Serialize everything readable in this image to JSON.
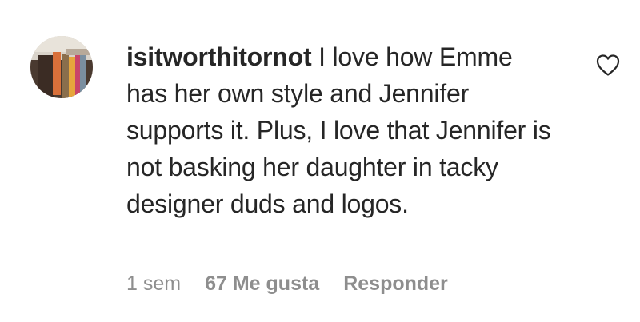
{
  "comment": {
    "username": "isitworthitornot",
    "text": "I love how Emme has her own style and Jennifer supports it. Plus, I love that Jennifer is not basking her daughter in tacky designer duds and logos.",
    "time": "1 sem",
    "likes": "67 Me gusta",
    "reply_label": "Responder",
    "like_icon": "heart-outline-icon"
  },
  "colors": {
    "text": "#262626",
    "secondary": "#8e8e8e",
    "background": "#ffffff"
  }
}
